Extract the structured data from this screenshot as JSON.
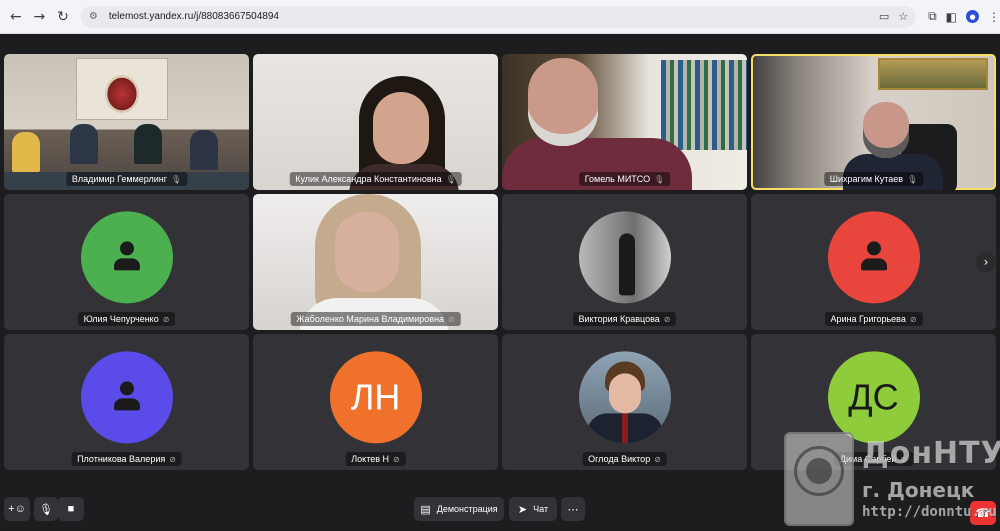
{
  "browser": {
    "url": "telemost.yandex.ru/j/88083667504894",
    "nav": {
      "back": "←",
      "forward": "→",
      "reload": "↻"
    }
  },
  "participants": [
    {
      "name": "Владимир Геммерлинг",
      "kind": "video",
      "scene": "hall",
      "mic": "on"
    },
    {
      "name": "Кулик Александра Константиновна",
      "kind": "video",
      "scene": "woman1",
      "mic": "on"
    },
    {
      "name": "Гомель МИТСО",
      "kind": "video",
      "scene": "library",
      "mic": "on"
    },
    {
      "name": "Шихрагим Кутаев",
      "kind": "video",
      "scene": "office",
      "mic": "on",
      "speaking": true
    },
    {
      "name": "Юлия Чепурченко",
      "kind": "avatar",
      "color": "#4caf50",
      "initials": "",
      "mic": "off"
    },
    {
      "name": "Жаболенко Марина Владимировна",
      "kind": "video",
      "scene": "woman2",
      "mic": "off"
    },
    {
      "name": "Виктория Кравцова",
      "kind": "photo",
      "photo": "bw",
      "mic": "off"
    },
    {
      "name": "Арина Григорьева",
      "kind": "avatar",
      "color": "#e8453c",
      "initials": "",
      "mic": "off"
    },
    {
      "name": "Плотникова Валерия",
      "kind": "avatar",
      "color": "#5b4be8",
      "initials": "",
      "mic": "off"
    },
    {
      "name": "Локтев Н",
      "kind": "avatar",
      "color": "#f0712c",
      "initials": "ЛН",
      "mic": "off"
    },
    {
      "name": "Оглода Виктор",
      "kind": "photo",
      "photo": "boy",
      "mic": "off"
    },
    {
      "name": "Дима Сарбей",
      "kind": "avatar",
      "color": "#8fcc3c",
      "initials": "ДС",
      "mic": "off"
    }
  ],
  "toolbar": {
    "share_label": "Демонстрация",
    "chat_label": "Чат",
    "more_label": "⋯"
  },
  "watermark": {
    "line1": "ДонНТУ",
    "line2": "г. Донецк",
    "line3": "http://donntu.ru"
  },
  "colors": {
    "speaking_border": "#f5dd6a",
    "leave": "#e33333",
    "background": "#1d1d1f",
    "tile": "#333337"
  }
}
